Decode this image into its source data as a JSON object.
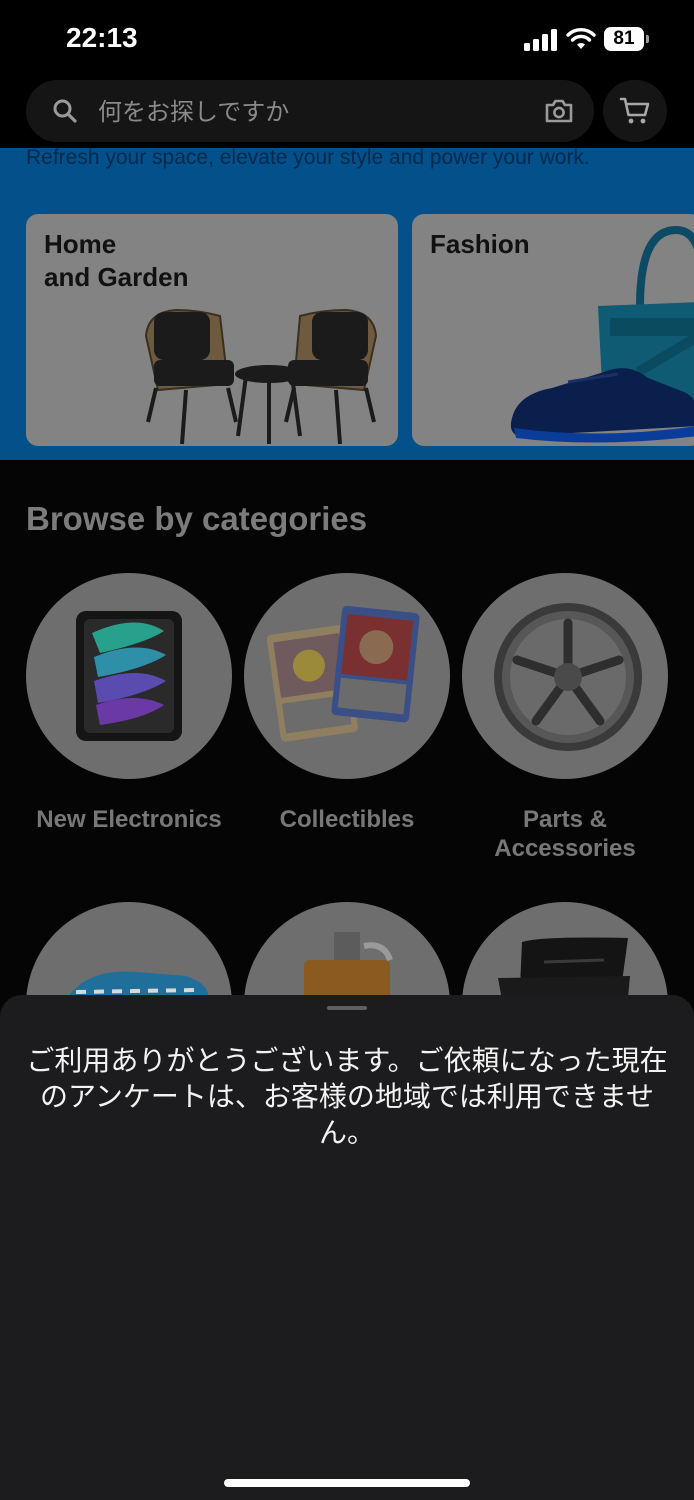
{
  "status_bar": {
    "time": "22:13",
    "battery": "81",
    "icons": [
      "signal-icon",
      "wifi-icon",
      "battery-icon"
    ]
  },
  "header": {
    "search_placeholder": "何をお探しですか",
    "icons": [
      "search-icon",
      "camera-icon",
      "cart-icon"
    ]
  },
  "promo": {
    "tagline": "Refresh your space, elevate your style and power your work.",
    "cards": [
      {
        "title": "Home\nand Garden"
      },
      {
        "title": "Fashion"
      }
    ],
    "band_color": "#04508a"
  },
  "browse": {
    "title": "Browse by categories",
    "categories": [
      {
        "label": "New Electronics"
      },
      {
        "label": "Collectibles"
      },
      {
        "label": "Parts &\nAccessories"
      }
    ]
  },
  "sheet": {
    "message": "ご利用ありがとうございます。ご依頼になった現在のアンケートは、お客様の地域では利用できません。"
  }
}
